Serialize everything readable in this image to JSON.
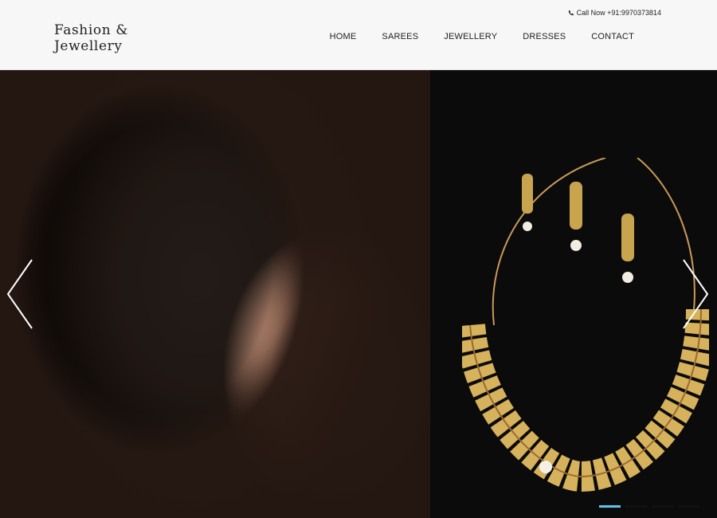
{
  "brand": {
    "line1": "Fashion &",
    "line2": "Jewellery"
  },
  "topbar": {
    "call_text": "Call Now +91:9970373814",
    "icon": "phone-icon"
  },
  "nav": {
    "items": [
      {
        "label": "HOME"
      },
      {
        "label": "SAREES"
      },
      {
        "label": "JEWELLERY"
      },
      {
        "label": "DRESSES"
      },
      {
        "label": "CONTACT"
      }
    ]
  },
  "slider": {
    "prev_icon": "chevron-left-icon",
    "next_icon": "chevron-right-icon",
    "indicator_count": 4,
    "active_index": 0,
    "accent_color": "#5fc5e8",
    "background_color": "#0b0b0b"
  }
}
